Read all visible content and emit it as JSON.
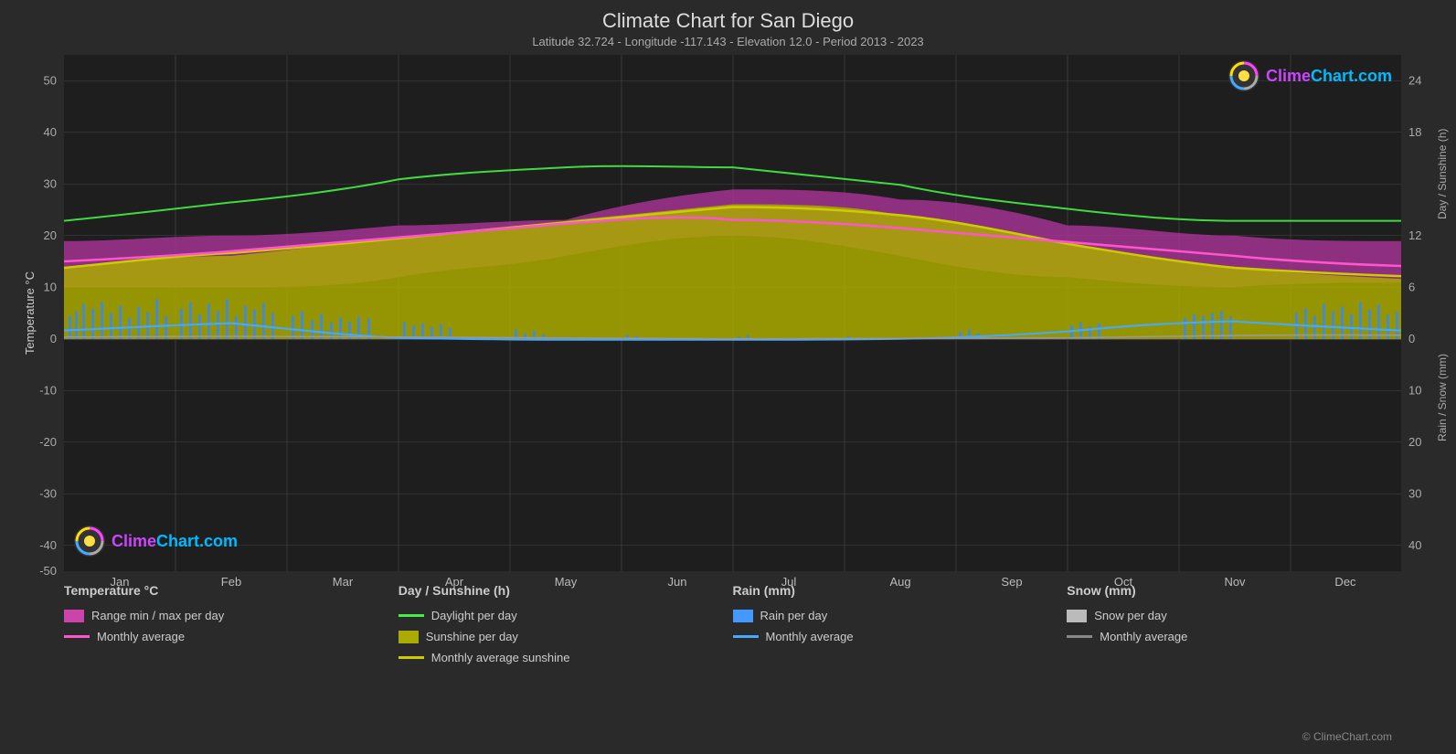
{
  "title": "Climate Chart for San Diego",
  "subtitle": "Latitude 32.724 - Longitude -117.143 - Elevation 12.0 - Period 2013 - 2023",
  "watermark": "ClimeChart.com",
  "copyright": "© ClimeChart.com",
  "yAxisLeft": "Temperature °C",
  "yAxisRightTop": "Day / Sunshine (h)",
  "yAxisRightBottom": "Rain / Snow (mm)",
  "months": [
    "Jan",
    "Feb",
    "Mar",
    "Apr",
    "May",
    "Jun",
    "Jul",
    "Aug",
    "Sep",
    "Oct",
    "Nov",
    "Dec"
  ],
  "legend": {
    "col1": {
      "title": "Temperature °C",
      "items": [
        {
          "type": "swatch",
          "color": "#cc44aa",
          "label": "Range min / max per day"
        },
        {
          "type": "line",
          "color": "#ff55cc",
          "label": "Monthly average"
        }
      ]
    },
    "col2": {
      "title": "Day / Sunshine (h)",
      "items": [
        {
          "type": "line",
          "color": "#44ee44",
          "label": "Daylight per day"
        },
        {
          "type": "swatch",
          "color": "#cccc00",
          "label": "Sunshine per day"
        },
        {
          "type": "line",
          "color": "#aaaa00",
          "label": "Monthly average sunshine"
        }
      ]
    },
    "col3": {
      "title": "Rain (mm)",
      "items": [
        {
          "type": "swatch",
          "color": "#4499ff",
          "label": "Rain per day"
        },
        {
          "type": "line",
          "color": "#44aaff",
          "label": "Monthly average"
        }
      ]
    },
    "col4": {
      "title": "Snow (mm)",
      "items": [
        {
          "type": "swatch",
          "color": "#bbbbbb",
          "label": "Snow per day"
        },
        {
          "type": "line",
          "color": "#888888",
          "label": "Monthly average"
        }
      ]
    }
  }
}
